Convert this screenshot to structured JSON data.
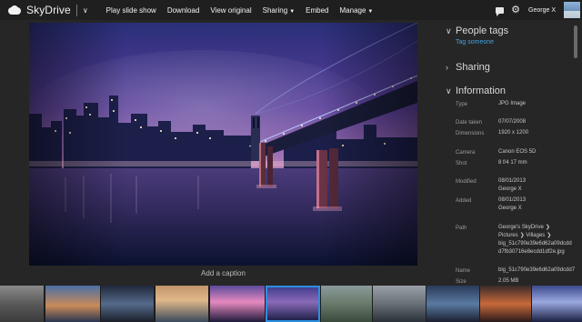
{
  "app": {
    "brand": "SkyDrive"
  },
  "toolbar": {
    "items": [
      {
        "label": "Play slide show"
      },
      {
        "label": "Download"
      },
      {
        "label": "View original"
      },
      {
        "label": "Sharing",
        "dropdown": true
      },
      {
        "label": "Embed"
      },
      {
        "label": "Manage",
        "dropdown": true
      }
    ]
  },
  "user": {
    "name": "George X"
  },
  "photo": {
    "caption_placeholder": "Add a caption"
  },
  "panel": {
    "people_tags": {
      "title": "People tags",
      "action": "Tag someone"
    },
    "sharing": {
      "title": "Sharing"
    },
    "information": {
      "title": "Information",
      "type_label": "Type",
      "type_value": "JPG Image",
      "date_label": "Date taken",
      "date_value": "07/07/2008",
      "dim_label": "Dimensions",
      "dim_value": "1920 x 1200",
      "camera_label": "Camera",
      "camera_value": "Canon EOS 5D",
      "shot_label": "Shot",
      "shot_value": "8 f/4 17 mm",
      "modified_label": "Modified",
      "modified_date": "08/01/2013",
      "modified_by": "George X",
      "added_label": "Added",
      "added_date": "08/01/2013",
      "added_by": "George X",
      "path_label": "Path",
      "path_line1": "George's SkyDrive",
      "path_line2a": "Pictures",
      "path_line2b": "Villages",
      "path_line3": "big_51c790e39e6d62a09dcdd",
      "path_line4": "d7fb30716e8ecdd1df2e.jpg",
      "name_label": "Name",
      "name_value": "big_51c790e39e6d62a09dcdd7",
      "size_label": "Size",
      "size_value": "2.05 MB"
    }
  },
  "icons": {
    "chevron": "chevron-down-icon",
    "messages": "chat-icon",
    "settings": "gear-icon",
    "section_open": "chevron-down-icon",
    "section_closed": "chevron-right-icon"
  },
  "colors": {
    "accent": "#3fa3e0",
    "topbar": "#1f1f1f",
    "background": "#262626",
    "selected_thumb": "#2d8fe0"
  }
}
